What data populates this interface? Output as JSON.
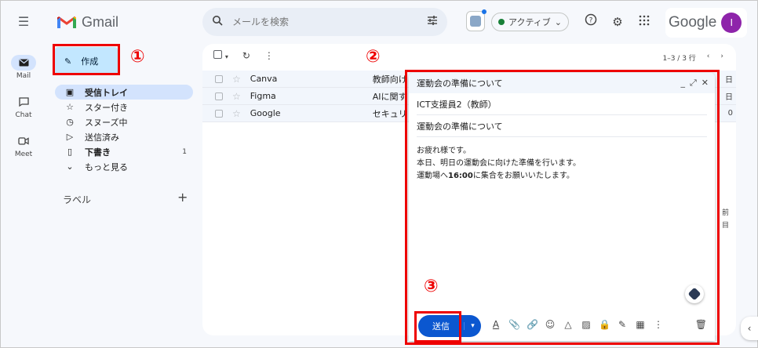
{
  "app": {
    "logo_text": "Gmail",
    "google_text": "Google",
    "avatar_initial": "I"
  },
  "search": {
    "placeholder": "メールを検索"
  },
  "status": {
    "label": "アクティブ"
  },
  "rail": [
    {
      "label": "Mail",
      "icon": "mail-icon",
      "active": true
    },
    {
      "label": "Chat",
      "icon": "chat-icon"
    },
    {
      "label": "Meet",
      "icon": "meet-icon"
    }
  ],
  "compose_button": {
    "label": "作成"
  },
  "nav": [
    {
      "label": "受信トレイ",
      "icon": "inbox-icon",
      "active": true
    },
    {
      "label": "スター付き",
      "icon": "star-icon"
    },
    {
      "label": "スヌーズ中",
      "icon": "snooze-icon"
    },
    {
      "label": "送信済み",
      "icon": "send-icon"
    },
    {
      "label": "下書き",
      "icon": "draft-icon",
      "count": "1",
      "bold": true
    },
    {
      "label": "もっと見る",
      "icon": "chevron-down-icon"
    }
  ],
  "labels_title": "ラベル",
  "pager": {
    "range": "1–3 / 3 行"
  },
  "emails": [
    {
      "sender": "Canva",
      "subject": "教師向け",
      "date_frag": "日"
    },
    {
      "sender": "Figma",
      "subject": "AIに関す",
      "date_frag": "日"
    },
    {
      "sender": "Google",
      "subject": "セキュリ",
      "date_frag": "0"
    }
  ],
  "side_fragments": [
    "前",
    "目"
  ],
  "compose_window": {
    "title": "運動会の準備について",
    "to": "ICT支援員2（教師）",
    "subject": "運動会の準備について",
    "body_line1": "お疲れ様です。",
    "body_line2": "本日、明日の運動会に向けた準備を行います。",
    "body_line3_pre": "運動場へ",
    "body_line3_bold": "16:00",
    "body_line3_post": "に集合をお願いいたします。",
    "send_label": "送信"
  },
  "annotations": [
    "①",
    "②",
    "③"
  ],
  "colors": {
    "accent": "#0b57d0",
    "highlight": "#e00000",
    "compose_bg": "#c2e7ff"
  }
}
